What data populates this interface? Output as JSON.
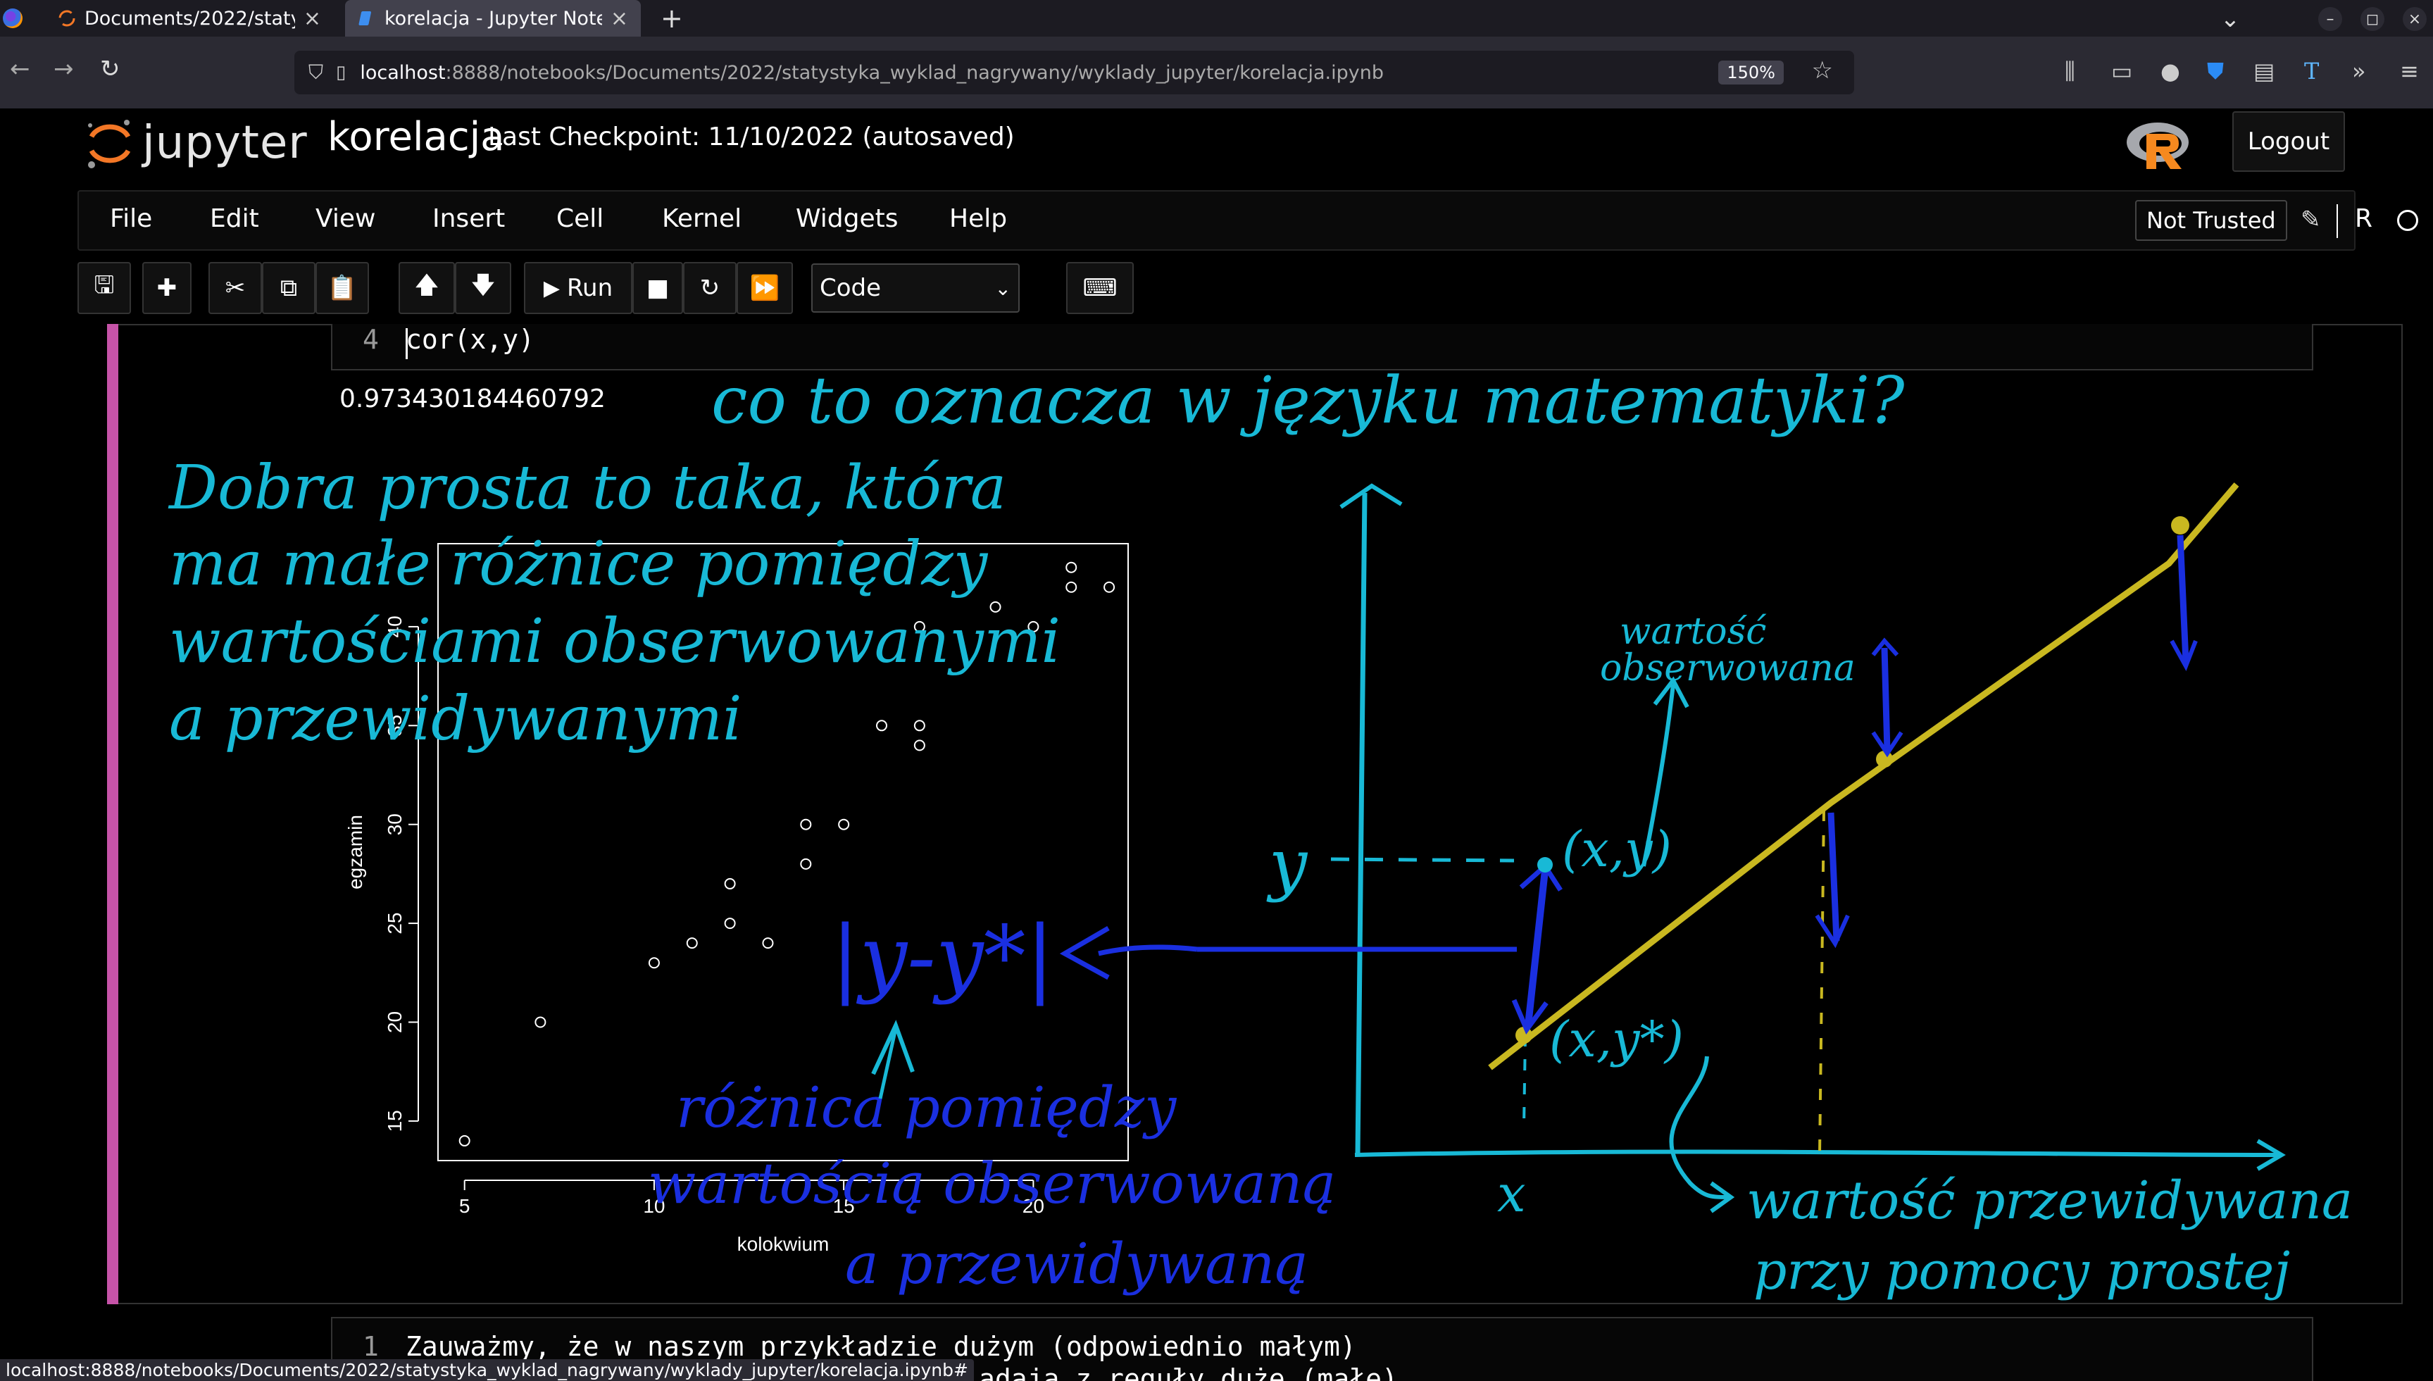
{
  "browser": {
    "tabs": [
      {
        "title": "Documents/2022/statystyka_",
        "active": false
      },
      {
        "title": "korelacja - Jupyter Notebo",
        "active": true
      }
    ],
    "new_tab": "+",
    "url_host": "localhost",
    "url_path": ":8888/notebooks/Documents/2022/statystyka_wyklad_nagrywany/wyklady_jupyter/korelacja.ipynb",
    "zoom": "150%",
    "status_url": "localhost:8888/notebooks/Documents/2022/statystyka_wyklad_nagrywany/wyklady_jupyter/korelacja.ipynb#"
  },
  "jupyter": {
    "logo_text": "jupyter",
    "notebook_name": "korelacja",
    "checkpoint": "Last Checkpoint: 11/10/2022   (autosaved)",
    "logout": "Logout",
    "menu": [
      "File",
      "Edit",
      "View",
      "Insert",
      "Cell",
      "Kernel",
      "Widgets",
      "Help"
    ],
    "not_trusted": "Not Trusted",
    "kernel": "R",
    "toolbar": {
      "run": "Run",
      "cell_type": "Code"
    }
  },
  "cell": {
    "line_number": "4",
    "code": "cor(x,y)",
    "output": "0.973430184460792"
  },
  "next_cell": {
    "line_number": "1",
    "line1": "Zauważmy, że w naszym przykładzie dużym (odpowiednio małym)",
    "line2": "adaja z reguły duże (małe)"
  },
  "colors": {
    "accent_magenta": "#c653a8",
    "ink_cyan": "#18b9d6",
    "ink_blue": "#1a2fe0",
    "ink_yellow": "#c9b820"
  },
  "chart_data": {
    "type": "scatter",
    "xlabel": "kolokwium",
    "ylabel": "egzamin",
    "x_ticks": [
      5,
      10,
      15,
      20
    ],
    "y_ticks": [
      15,
      20,
      25,
      30,
      35,
      40
    ],
    "xlim": [
      4.3,
      22.5
    ],
    "ylim": [
      13,
      44.2
    ],
    "points": [
      {
        "x": 5,
        "y": 14
      },
      {
        "x": 7,
        "y": 20
      },
      {
        "x": 10,
        "y": 23
      },
      {
        "x": 11,
        "y": 24
      },
      {
        "x": 12,
        "y": 25
      },
      {
        "x": 12,
        "y": 27
      },
      {
        "x": 13,
        "y": 24
      },
      {
        "x": 14,
        "y": 28
      },
      {
        "x": 14,
        "y": 30
      },
      {
        "x": 15,
        "y": 30
      },
      {
        "x": 16,
        "y": 35
      },
      {
        "x": 17,
        "y": 34
      },
      {
        "x": 17,
        "y": 35
      },
      {
        "x": 17,
        "y": 40
      },
      {
        "x": 19,
        "y": 41
      },
      {
        "x": 20,
        "y": 40
      },
      {
        "x": 21,
        "y": 42
      },
      {
        "x": 21,
        "y": 43
      },
      {
        "x": 22,
        "y": 42
      }
    ]
  },
  "annotations": {
    "title": "co to oznacza w języku matematyki?",
    "note_lines": [
      "Dobra prosta to taka, która",
      "ma małe różnice pomiędzy",
      "wartościami obserwowanymi",
      "a przewidywanymi"
    ],
    "formula": "|y-y*|",
    "residual_lines": [
      "różnica pomiędzy",
      "wartością obserwowaną",
      "a przewidywaną"
    ],
    "observed": [
      "wartość",
      "obserwowana"
    ],
    "point_obs": "(x,y)",
    "point_pred": "(x,y*)",
    "y_label": "y",
    "x_label": "x",
    "predicted_lines": [
      "wartość przewidywana",
      "przy pomocy prostej"
    ]
  }
}
